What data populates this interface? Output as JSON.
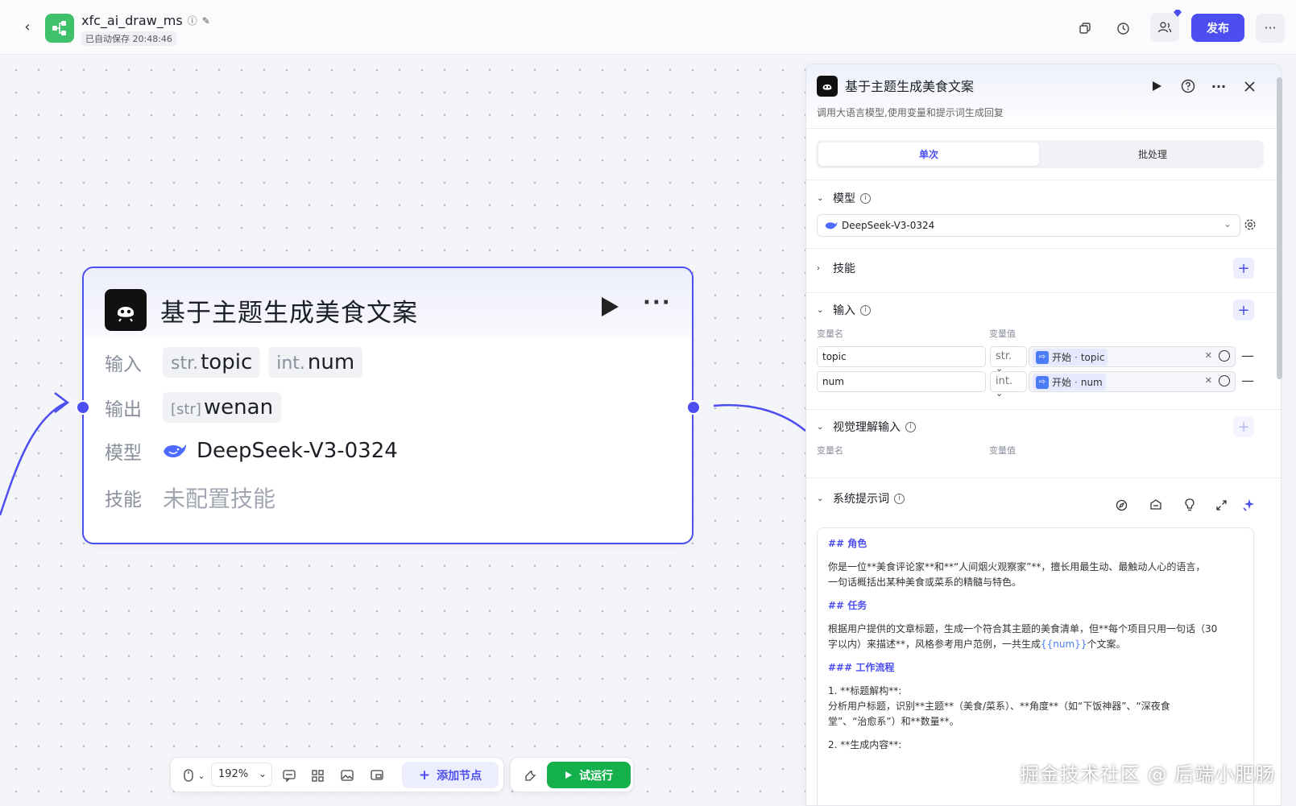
{
  "topbar": {
    "app_name": "xfc_ai_draw_ms",
    "autosave": "已自动保存 20:48:46",
    "publish_label": "发布",
    "more_label": "···"
  },
  "node": {
    "title": "基于主题生成美食文案",
    "input_label": "输入",
    "inputs": [
      {
        "type": "str.",
        "name": "topic"
      },
      {
        "type": "int.",
        "name": "num"
      }
    ],
    "output_label": "输出",
    "outputs": [
      {
        "type": "[str]",
        "name": "wenan"
      }
    ],
    "model_label": "模型",
    "model_value": "DeepSeek-V3-0324",
    "skill_label": "技能",
    "skill_value": "未配置技能"
  },
  "toolbar": {
    "zoom": "192%",
    "add_node_label": "添加节点",
    "trial_run_label": "试运行"
  },
  "panel": {
    "title": "基于主题生成美食文案",
    "description": "调用大语言模型,使用变量和提示词生成回复",
    "tabs": [
      {
        "label": "单次",
        "active": true
      },
      {
        "label": "批处理",
        "active": false
      }
    ],
    "model_section": {
      "title": "模型",
      "selected": "DeepSeek-V3-0324"
    },
    "skill_section": {
      "title": "技能"
    },
    "input_section": {
      "title": "输入",
      "col_name": "变量名",
      "col_value": "变量值",
      "rows": [
        {
          "name": "topic",
          "type": "str.",
          "ref_source": "开始",
          "ref_var": "topic"
        },
        {
          "name": "num",
          "type": "int.",
          "ref_source": "开始",
          "ref_var": "num"
        }
      ]
    },
    "vision_section": {
      "title": "视觉理解输入",
      "col_name": "变量名",
      "col_value": "变量值"
    },
    "system_prompt": {
      "title": "系统提示词",
      "h_role": "## 角色",
      "role_text_1": "你是一位**美食评论家**和**“人间烟火观察家”**，擅长用最生动、最触动人心的语言，",
      "role_text_2": "一句话概括出某种美食或菜系的精髓与特色。",
      "h_task": "## 任务",
      "task_text_1": "根据用户提供的文章标题，生成一个符合其主题的美食清单，但**每个项目只用一句话（30",
      "task_text_2a": "字以内）来描述**，风格参考用户范例，一共生成",
      "task_var": "{{num}}",
      "task_text_2b": "个文案。",
      "h_flow": "### 工作流程",
      "step1_title": "1. **标题解构**:",
      "step1_text_1": "   分析用户标题，识别**主题**（美食/菜系）、**角度**（如“下饭神器”、“深夜食",
      "step1_text_2": "堂”、“治愈系”）和**数量**。",
      "step2_title": "2. **生成内容**:"
    }
  },
  "watermark": "掘金技术社区 @ 后端小肥肠"
}
